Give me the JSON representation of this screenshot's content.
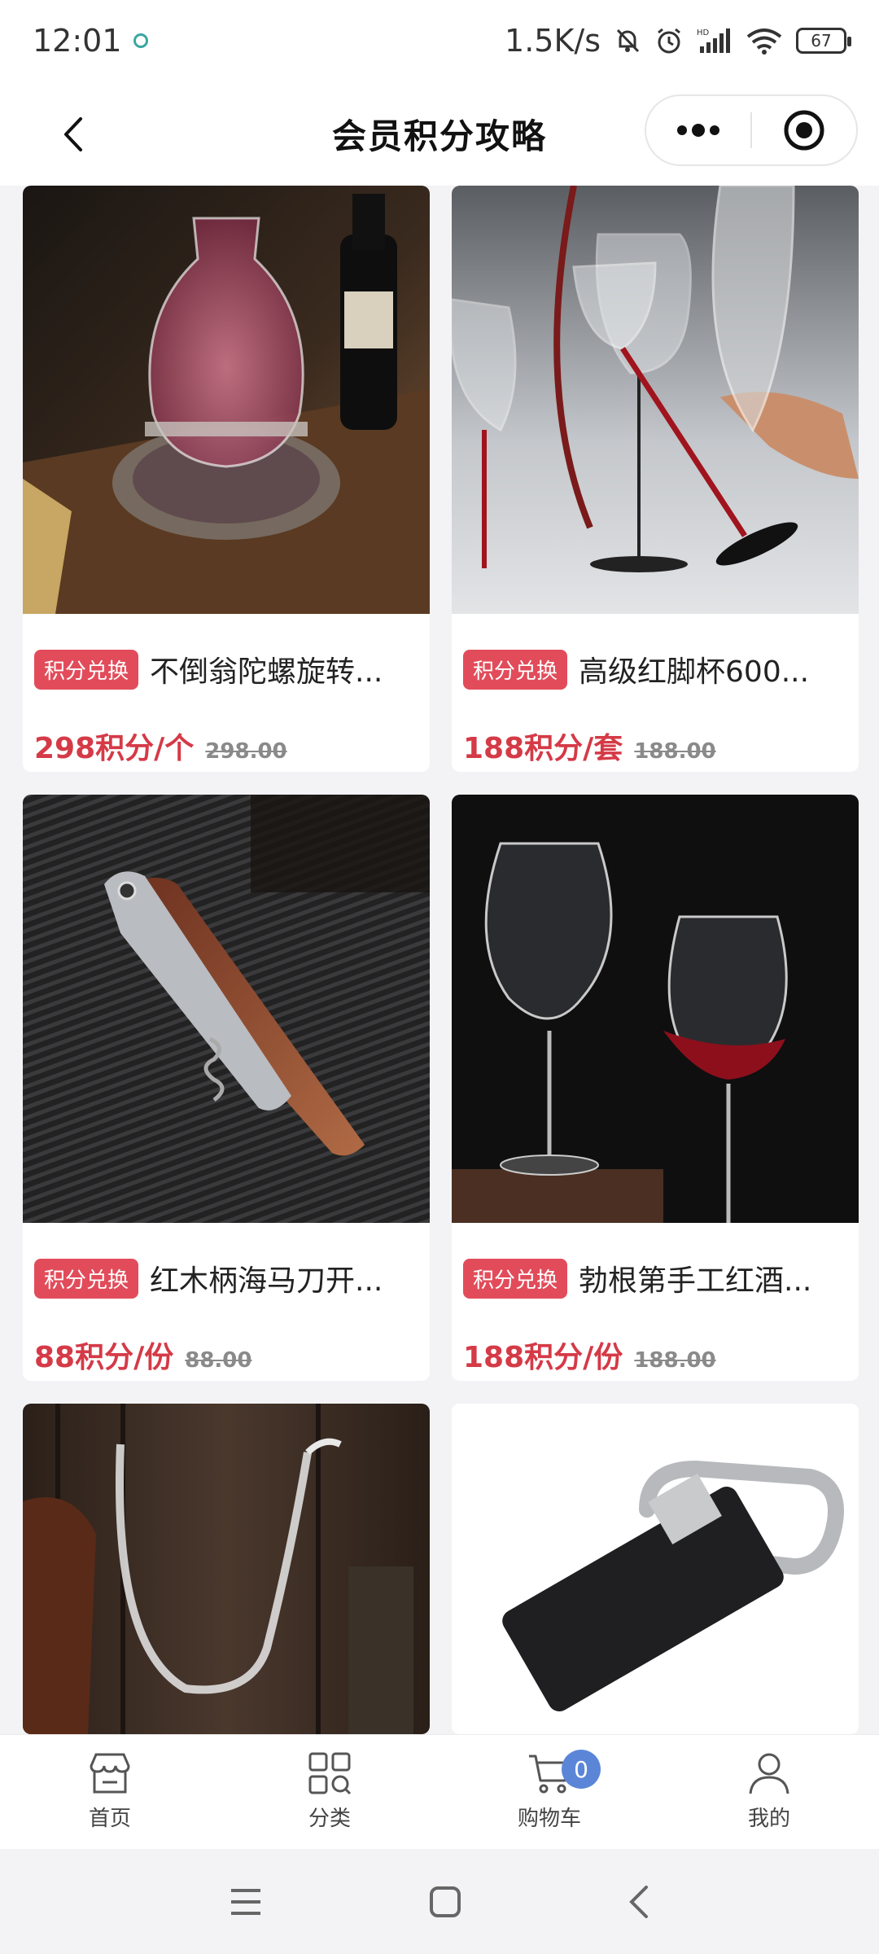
{
  "status_bar": {
    "time": "12:01",
    "net_speed": "1.5K/s",
    "battery": "67"
  },
  "header": {
    "title": "会员积分攻略"
  },
  "products": [
    {
      "badge": "积分兑换",
      "title": "不倒翁陀螺旋转...",
      "price": "298积分/个",
      "original_price": "298.00"
    },
    {
      "badge": "积分兑换",
      "title": "高级红脚杯600...",
      "price": "188积分/套",
      "original_price": "188.00"
    },
    {
      "badge": "积分兑换",
      "title": "红木柄海马刀开...",
      "price": "88积分/份",
      "original_price": "88.00"
    },
    {
      "badge": "积分兑换",
      "title": "勃根第手工红酒...",
      "price": "188积分/份",
      "original_price": "188.00"
    }
  ],
  "tabbar": {
    "items": [
      {
        "label": "首页",
        "icon": "store-icon"
      },
      {
        "label": "分类",
        "icon": "category-search-icon"
      },
      {
        "label": "购物车",
        "icon": "cart-icon",
        "badge": "0"
      },
      {
        "label": "我的",
        "icon": "user-icon"
      }
    ]
  },
  "colors": {
    "accent": "#e24c5a",
    "price": "#d53a47",
    "cart_badge": "#5b86d8"
  }
}
